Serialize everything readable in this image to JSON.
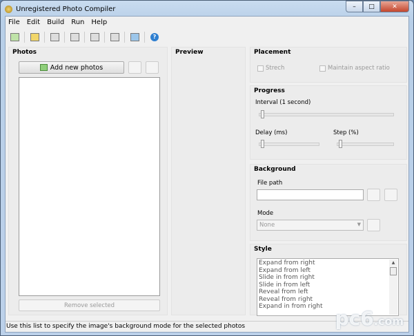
{
  "window": {
    "title": "Unregistered Photo Compiler",
    "minimize": "–",
    "maximize": "□",
    "close": "✕"
  },
  "menu": [
    "File",
    "Edit",
    "Build",
    "Run",
    "Help"
  ],
  "toolbar": [
    "add-photo",
    "open",
    "save",
    "build",
    "build-all",
    "export",
    "preview",
    "help"
  ],
  "photos": {
    "heading": "Photos",
    "add_label": "Add new photos",
    "remove_label": "Remove selected"
  },
  "preview": {
    "heading": "Preview"
  },
  "placement": {
    "heading": "Placement",
    "stretch": "Strech",
    "aspect": "Maintain aspect ratio"
  },
  "progress": {
    "heading": "Progress",
    "interval": "Interval (1 second)",
    "delay": "Delay (ms)",
    "step": "Step (%)"
  },
  "background": {
    "heading": "Background",
    "file_path": "File path",
    "file_value": "",
    "mode": "Mode",
    "mode_value": "None"
  },
  "style": {
    "heading": "Style",
    "items": [
      "Expand from right",
      "Expand from left",
      "Slide in from right",
      "Slide in from left",
      "Reveal from left",
      "Reveal from right",
      "Expand in from right"
    ]
  },
  "status": "Use this list to specify the image's background mode for the selected photos",
  "watermark": "pc6.com"
}
